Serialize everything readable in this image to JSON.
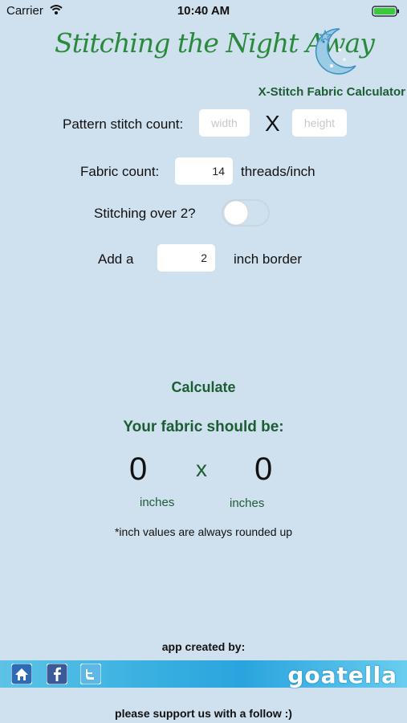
{
  "status_bar": {
    "carrier": "Carrier",
    "time": "10:40 AM"
  },
  "header": {
    "logo_text": "Stitching the Night Away",
    "subtitle": "X-Stitch Fabric Calculator"
  },
  "form": {
    "pattern_label": "Pattern stitch count:",
    "width_placeholder": "width",
    "separator": "X",
    "height_placeholder": "height",
    "fabric_label": "Fabric count:",
    "fabric_value": "14",
    "fabric_unit": "threads/inch",
    "over2_label": "Stitching over 2?",
    "over2_on": false,
    "border_prefix": "Add a",
    "border_value": "2",
    "border_suffix": "inch border"
  },
  "calculate_label": "Calculate",
  "result": {
    "title": "Your fabric should be:",
    "width": "0",
    "separator": "x",
    "height": "0",
    "width_unit": "inches",
    "height_unit": "inches",
    "note": "*inch values are always rounded up"
  },
  "footer": {
    "created_by": "app created by:",
    "brand": "goatella",
    "support": "please support us with a follow :)"
  },
  "colors": {
    "background": "#cfe0ee",
    "accent_green": "#1c5e33",
    "banner_blue": "#36aee0"
  },
  "icons": [
    "wifi-icon",
    "battery-icon",
    "moon-logo-icon",
    "home-icon",
    "facebook-icon",
    "twitter-icon"
  ]
}
